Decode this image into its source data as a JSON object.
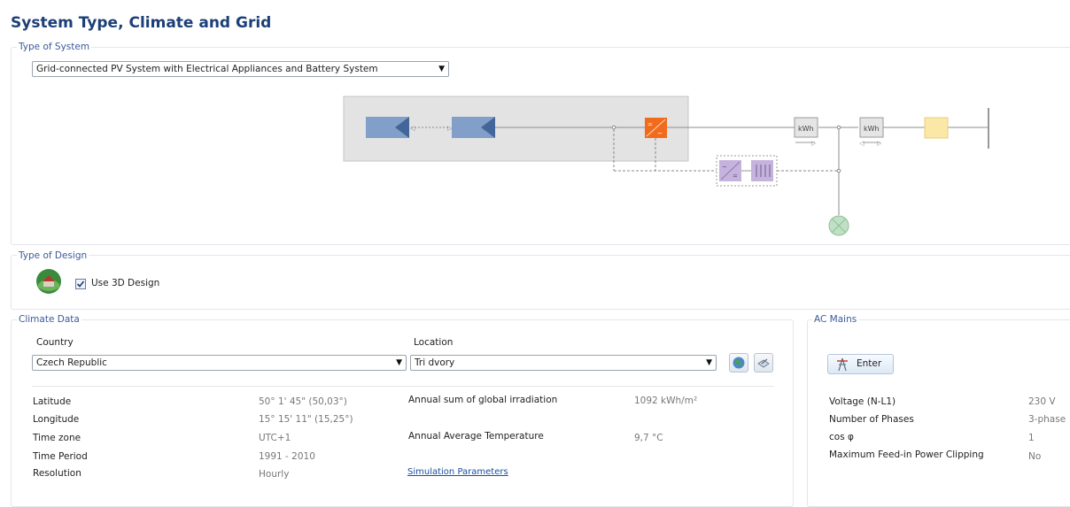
{
  "page": {
    "title": "System Type, Climate and Grid"
  },
  "type_of_system": {
    "group_label": "Type of System",
    "selected": "Grid-connected PV System with Electrical Appliances and Battery System"
  },
  "diagram": {
    "meter1_label": "kWh",
    "meter2_label": "kWh"
  },
  "type_of_design": {
    "group_label": "Type of Design",
    "checkbox_label": "Use 3D Design",
    "checked": true
  },
  "climate": {
    "group_label": "Climate Data",
    "country_label": "Country",
    "country_value": "Czech Republic",
    "location_label": "Location",
    "location_value": "Tri dvory",
    "rows": [
      {
        "label": "Latitude",
        "value": "50° 1' 45\"  (50,03°)"
      },
      {
        "label": "Longitude",
        "value": "15° 15' 11\"  (15,25°)"
      },
      {
        "label": "Time zone",
        "value": "UTC+1"
      },
      {
        "label": "Time Period",
        "value": "1991 - 2010"
      },
      {
        "label": "Resolution",
        "value": "Hourly"
      }
    ],
    "irradiation_label": "Annual sum of global irradiation",
    "irradiation_value": "1092 kWh/m²",
    "temperature_label": "Annual Average Temperature",
    "temperature_value": "9,7 °C",
    "simulation_link": "Simulation Parameters"
  },
  "ac_mains": {
    "group_label": "AC Mains",
    "enter_label": "Enter",
    "rows": [
      {
        "label": "Voltage (N-L1)",
        "value": "230 V"
      },
      {
        "label": "Number of Phases",
        "value": "3-phase"
      },
      {
        "label": "cos φ",
        "value": "1"
      },
      {
        "label": "Maximum Feed-in Power Clipping",
        "value": "No"
      }
    ]
  },
  "colors": {
    "title": "#1c3f78",
    "group_label": "#3a5a9a",
    "pv_module": "#7f9ec8",
    "inverter": "#f26b1d",
    "battery": "#c5b3dd",
    "appliance": "#fbe8a6",
    "grid_lamp": "#bfe0c4"
  }
}
